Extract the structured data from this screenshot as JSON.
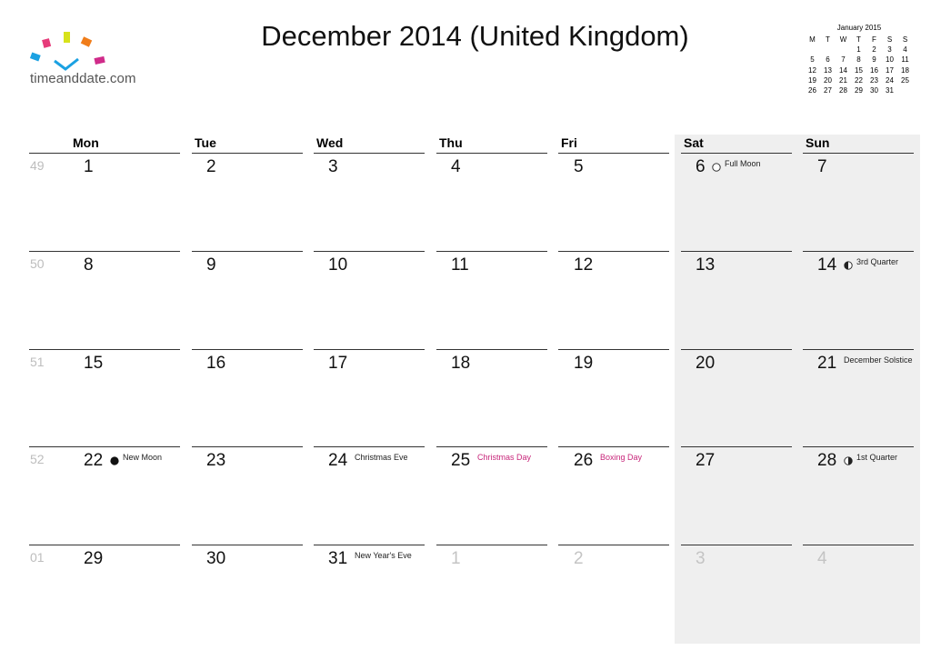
{
  "logo": {
    "text": "timeanddate.com"
  },
  "title": "December 2014 (United Kingdom)",
  "mini_calendar": {
    "title": "January 2015",
    "headers": [
      "M",
      "T",
      "W",
      "T",
      "F",
      "S",
      "S"
    ],
    "rows": [
      [
        "",
        "",
        "1",
        "2",
        "3",
        "4"
      ],
      [
        "5",
        "6",
        "7",
        "8",
        "9",
        "10",
        "11"
      ],
      [
        "12",
        "13",
        "14",
        "15",
        "16",
        "17",
        "18"
      ],
      [
        "19",
        "20",
        "21",
        "22",
        "23",
        "24",
        "25"
      ],
      [
        "26",
        "27",
        "28",
        "29",
        "30",
        "31",
        ""
      ]
    ]
  },
  "weekdays": [
    "Mon",
    "Tue",
    "Wed",
    "Thu",
    "Fri",
    "Sat",
    "Sun"
  ],
  "weeks": [
    {
      "num": "49",
      "days": [
        "1",
        "2",
        "3",
        "4",
        "5",
        "6",
        "7"
      ]
    },
    {
      "num": "50",
      "days": [
        "8",
        "9",
        "10",
        "11",
        "12",
        "13",
        "14"
      ]
    },
    {
      "num": "51",
      "days": [
        "15",
        "16",
        "17",
        "18",
        "19",
        "20",
        "21"
      ]
    },
    {
      "num": "52",
      "days": [
        "22",
        "23",
        "24",
        "25",
        "26",
        "27",
        "28"
      ]
    },
    {
      "num": "01",
      "days": [
        "29",
        "30",
        "31",
        "1",
        "2",
        "3",
        "4"
      ]
    }
  ],
  "events": [
    {
      "week": 0,
      "day": 5,
      "text": "Full Moon",
      "moon": "full",
      "holiday": false
    },
    {
      "week": 1,
      "day": 6,
      "text": "3rd Quarter",
      "moon": "third",
      "holiday": false
    },
    {
      "week": 2,
      "day": 6,
      "text": "December Solstice",
      "moon": "",
      "holiday": false
    },
    {
      "week": 3,
      "day": 0,
      "text": "New Moon",
      "moon": "new",
      "holiday": false
    },
    {
      "week": 3,
      "day": 2,
      "text": "Christmas Eve",
      "moon": "",
      "holiday": false
    },
    {
      "week": 3,
      "day": 3,
      "text": "Christmas Day",
      "moon": "",
      "holiday": true
    },
    {
      "week": 3,
      "day": 4,
      "text": "Boxing Day",
      "moon": "",
      "holiday": true
    },
    {
      "week": 3,
      "day": 6,
      "text": "1st Quarter",
      "moon": "first",
      "holiday": false
    },
    {
      "week": 4,
      "day": 2,
      "text": "New Year's Eve",
      "moon": "",
      "holiday": false
    }
  ],
  "colors": {
    "holiday": "#c8267a",
    "weekend_bg": "#efefef",
    "other_month": "#c4c4c4",
    "week_number": "#bdbdbd"
  }
}
